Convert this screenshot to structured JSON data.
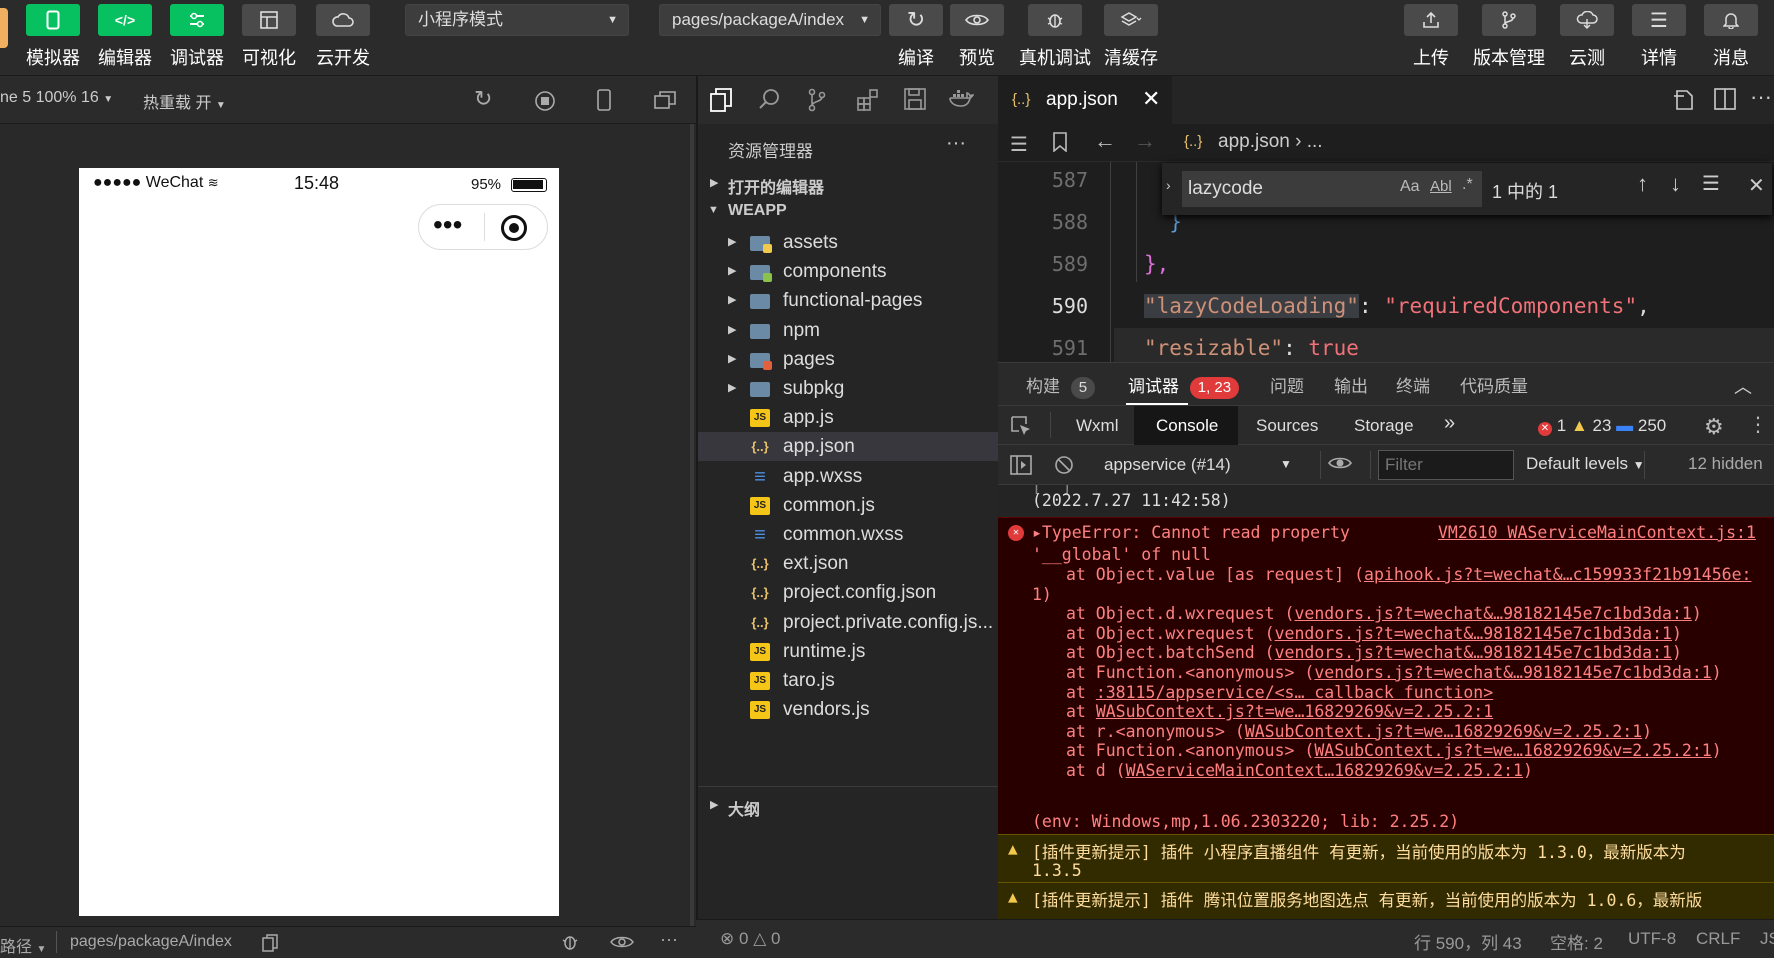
{
  "toolbar": {
    "buttons_left": [
      {
        "label": "模拟器",
        "icon": "phone-icon"
      },
      {
        "label": "编辑器",
        "icon": "code-icon"
      },
      {
        "label": "调试器",
        "icon": "debug-icon"
      },
      {
        "label": "可视化",
        "icon": "layout-icon"
      },
      {
        "label": "云开发",
        "icon": "cloud-icon"
      }
    ],
    "mode_select": "小程序模式",
    "page_select": "pages/packageA/index",
    "buttons_mid": [
      {
        "label": "编译",
        "icon": "refresh-icon"
      },
      {
        "label": "预览",
        "icon": "eye-icon"
      },
      {
        "label": "真机调试",
        "icon": "bug-icon"
      },
      {
        "label": "清缓存",
        "icon": "layers-icon"
      }
    ],
    "buttons_right": [
      {
        "label": "上传",
        "icon": "upload-icon"
      },
      {
        "label": "版本管理",
        "icon": "branch-icon"
      },
      {
        "label": "云测",
        "icon": "cloud-test-icon"
      },
      {
        "label": "详情",
        "icon": "menu-icon"
      },
      {
        "label": "消息",
        "icon": "bell-icon"
      }
    ]
  },
  "simulator": {
    "device_text": "ne 5 100% 16",
    "hot_reload": "热重载 开",
    "status": {
      "carrier": "●●●●● WeChat",
      "time": "15:48",
      "battery": "95%"
    },
    "capsule_dots": "•••",
    "footer": {
      "path_label": "路径",
      "path": "pages/packageA/index"
    }
  },
  "explorer": {
    "title": "资源管理器",
    "more": "···",
    "open_editors": "打开的编辑器",
    "root": "WEAPP",
    "outline": "大纲",
    "items": [
      {
        "name": "assets",
        "type": "folder-assets"
      },
      {
        "name": "components",
        "type": "folder-components"
      },
      {
        "name": "functional-pages",
        "type": "folder"
      },
      {
        "name": "npm",
        "type": "folder"
      },
      {
        "name": "pages",
        "type": "folder-pages"
      },
      {
        "name": "subpkg",
        "type": "folder"
      },
      {
        "name": "app.js",
        "type": "js"
      },
      {
        "name": "app.json",
        "type": "json"
      },
      {
        "name": "app.wxss",
        "type": "css"
      },
      {
        "name": "common.js",
        "type": "js"
      },
      {
        "name": "common.wxss",
        "type": "css"
      },
      {
        "name": "ext.json",
        "type": "json"
      },
      {
        "name": "project.config.json",
        "type": "json"
      },
      {
        "name": "project.private.config.js...",
        "type": "json"
      },
      {
        "name": "runtime.js",
        "type": "js"
      },
      {
        "name": "taro.js",
        "type": "js"
      },
      {
        "name": "vendors.js",
        "type": "js"
      }
    ]
  },
  "editor": {
    "tab": "app.json",
    "breadcrumb": "app.json",
    "breadcrumb_more": "...",
    "json_icon": "{..}",
    "find": {
      "query": "lazycode",
      "case": "Aa",
      "word": "Abl",
      "regex": ".*",
      "result": "1 中的 1"
    },
    "lines": [
      {
        "num": "587",
        "code": ""
      },
      {
        "num": "588",
        "code": "  }"
      },
      {
        "num": "589",
        "code": "},"
      },
      {
        "num": "590",
        "key": "\"lazyCodeLoading\"",
        "colon": ": ",
        "value": "\"requiredComponents\"",
        "tail": ","
      },
      {
        "num": "591",
        "key": "\"resizable\"",
        "colon": ": ",
        "value": "true"
      }
    ]
  },
  "devtools": {
    "tabs1": [
      {
        "label": "构建",
        "badge": "5"
      },
      {
        "label": "调试器",
        "badge": "1, 23"
      },
      {
        "label": "问题"
      },
      {
        "label": "输出"
      },
      {
        "label": "终端"
      },
      {
        "label": "代码质量"
      }
    ],
    "tabs2": [
      "Wxml",
      "Console",
      "Sources",
      "Storage"
    ],
    "more_tabs": "»",
    "counts": {
      "errors": "1",
      "warnings": "23",
      "infos": "250"
    },
    "context": "appservice (#14)",
    "filter_placeholder": "Filter",
    "levels": "Default levels",
    "hidden": "12 hidden",
    "console": {
      "timestamp": "(2022.7.27 11:42:58)",
      "error_head": "TypeError: Cannot read property",
      "error_head2": "'__global' of null",
      "error_src": "VM2610 WAServiceMainContext.js:1",
      "stack": [
        {
          "pre": "at Object.value [as request] (",
          "link": "apihook.js?t=wechat&…c159933f21b91456e:",
          "post": ""
        },
        {
          "pre": "1)",
          "link": "",
          "post": "",
          "outdent": true
        },
        {
          "pre": "at Object.d.wxrequest (",
          "link": "vendors.js?t=wechat&…98182145e7c1bd3da:1",
          "post": ")"
        },
        {
          "pre": "at Object.wxrequest (",
          "link": "vendors.js?t=wechat&…98182145e7c1bd3da:1",
          "post": ")"
        },
        {
          "pre": "at Object.batchSend (",
          "link": "vendors.js?t=wechat&…98182145e7c1bd3da:1",
          "post": ")"
        },
        {
          "pre": "at Function.<anonymous> (",
          "link": "vendors.js?t=wechat&…98182145e7c1bd3da:1",
          "post": ")"
        },
        {
          "pre": "at ",
          "link": ":38115/appservice/<s… callback function>",
          "post": ""
        },
        {
          "pre": "at ",
          "link": "WASubContext.js?t=we…16829269&v=2.25.2:1",
          "post": ""
        },
        {
          "pre": "at r.<anonymous> (",
          "link": "WASubContext.js?t=we…16829269&v=2.25.2:1",
          "post": ")"
        },
        {
          "pre": "at Function.<anonymous> (",
          "link": "WASubContext.js?t=we…16829269&v=2.25.2:1",
          "post": ")"
        },
        {
          "pre": "at d (",
          "link": "WAServiceMainContext…16829269&v=2.25.2:1",
          "post": ")"
        }
      ],
      "env": "(env: Windows,mp,1.06.2303220; lib: 2.25.2)",
      "warn1a": "[插件更新提示] 插件 小程序直播组件 有更新，当前使用的版本为 1.3.0，最新版本为",
      "warn1b": "1.3.5",
      "warn2": "[插件更新提示] 插件 腾讯位置服务地图选点 有更新，当前使用的版本为 1.0.6，最新版"
    }
  },
  "statusbar": {
    "problems_err": "0",
    "problems_warn": "0",
    "position": "行 590，列 43",
    "spaces": "空格: 2",
    "encoding": "UTF-8",
    "eol": "CRLF",
    "lang": "JS"
  },
  "colors": {
    "accent": "#07c160",
    "error_bg": "#290000",
    "warn_bg": "#332b00",
    "json_icon": "#e8c26a"
  }
}
